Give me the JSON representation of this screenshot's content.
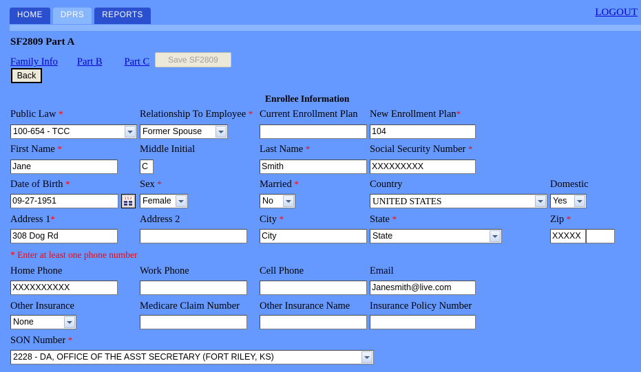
{
  "nav": {
    "tabs": [
      {
        "label": "HOME",
        "active": false
      },
      {
        "label": "DPRS",
        "active": true
      },
      {
        "label": "REPORTS",
        "active": false
      }
    ],
    "logout_label": "LOGOUT"
  },
  "header": {
    "page_title": "SF2809 Part A",
    "links": [
      {
        "label": "Family Info"
      },
      {
        "label": "Part B"
      },
      {
        "label": "Part C"
      }
    ],
    "save_label": "Save SF2809",
    "back_label": "Back"
  },
  "form": {
    "section_title": "Enrollee Information",
    "phone_note": "* Enter at least one phone number",
    "required_mark": "*",
    "fields": {
      "public_law": {
        "label": "Public Law",
        "value": "100-654 - TCC",
        "type": "select"
      },
      "relationship": {
        "label": "Relationship To Employee",
        "value": "Former Spouse",
        "type": "select"
      },
      "current_plan": {
        "label": "Current Enrollment Plan",
        "value": "",
        "type": "text"
      },
      "new_plan": {
        "label": "New Enrollment Plan",
        "value": "104",
        "type": "text"
      },
      "first_name": {
        "label": "First Name",
        "value": "Jane",
        "type": "text"
      },
      "middle_initial": {
        "label": "Middle Initial",
        "value": "C",
        "type": "text"
      },
      "last_name": {
        "label": "Last Name",
        "value": "Smith",
        "type": "text"
      },
      "ssn": {
        "label": "Social Security Number",
        "value": "XXXXXXXXX",
        "type": "text"
      },
      "dob": {
        "label": "Date of Birth",
        "value": "09-27-1951",
        "type": "text"
      },
      "sex": {
        "label": "Sex",
        "value": "Female",
        "type": "select"
      },
      "married": {
        "label": "Married",
        "value": "No",
        "type": "select"
      },
      "country": {
        "label": "Country",
        "value": "UNITED STATES",
        "type": "select"
      },
      "domestic": {
        "label": "Domestic",
        "value": "Yes",
        "type": "select"
      },
      "address1": {
        "label": "Address 1",
        "value": "308 Dog Rd",
        "type": "text"
      },
      "address2": {
        "label": "Address 2",
        "value": "",
        "type": "text"
      },
      "city": {
        "label": "City",
        "value": "City",
        "type": "text"
      },
      "state": {
        "label": "State",
        "value": "State",
        "type": "select"
      },
      "zip": {
        "label": "Zip",
        "value": "XXXXX",
        "value2": "",
        "type": "text"
      },
      "home_phone": {
        "label": "Home Phone",
        "value": "XXXXXXXXXX",
        "type": "text"
      },
      "work_phone": {
        "label": "Work Phone",
        "value": "",
        "type": "text"
      },
      "cell_phone": {
        "label": "Cell Phone",
        "value": "",
        "type": "text"
      },
      "email": {
        "label": "Email",
        "value": "Janesmith@live.com",
        "type": "text"
      },
      "other_insurance": {
        "label": "Other Insurance",
        "value": "None",
        "type": "select"
      },
      "medicare_claim": {
        "label": "Medicare Claim Number",
        "value": "",
        "type": "text"
      },
      "other_insurance_name": {
        "label": "Other Insurance Name",
        "value": "",
        "type": "text"
      },
      "insurance_policy": {
        "label": "Insurance Policy Number",
        "value": "",
        "type": "text"
      },
      "son_number": {
        "label": "SON Number",
        "value": "2228 - DA, OFFICE OF THE ASST SECRETARY (FORT RILEY, KS)",
        "type": "select"
      }
    }
  },
  "icons": {
    "calendar": "calendar-picker-icon",
    "dropdown": "chevron-down-icon"
  },
  "colors": {
    "page_background": "#6699ff",
    "tab_active": "#88b6ff",
    "tab_inactive": "#2a4fcf",
    "link": "#0000cc",
    "required": "#ff0000",
    "button_face": "#ece9d8"
  }
}
